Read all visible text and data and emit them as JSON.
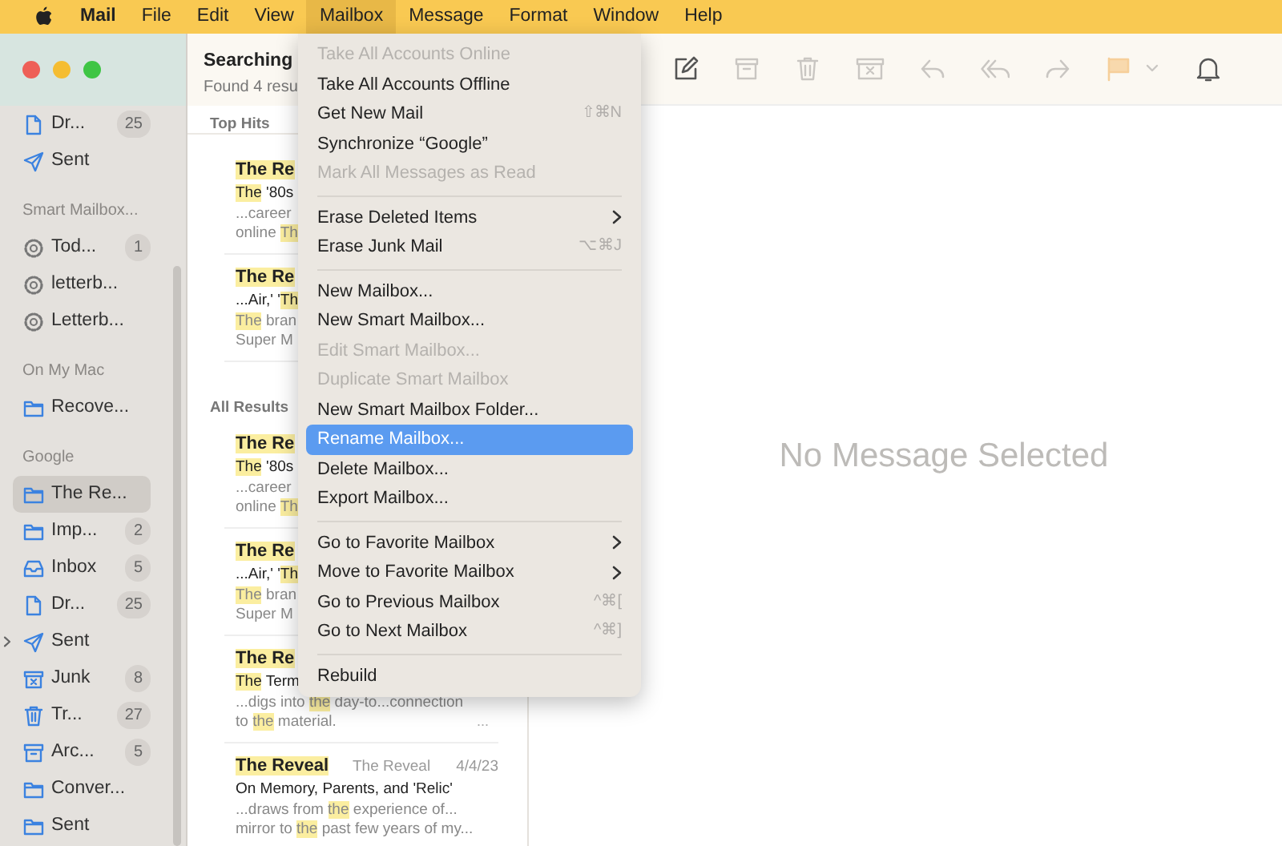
{
  "menubar": [
    {
      "kind": "apple",
      "selected": false
    },
    {
      "kind": "app",
      "label": "Mail",
      "selected": false
    },
    {
      "kind": "menu",
      "label": "File",
      "selected": false
    },
    {
      "kind": "menu",
      "label": "Edit",
      "selected": false
    },
    {
      "kind": "menu",
      "label": "View",
      "selected": false
    },
    {
      "kind": "menu",
      "label": "Mailbox",
      "selected": true
    },
    {
      "kind": "menu",
      "label": "Message",
      "selected": false
    },
    {
      "kind": "menu",
      "label": "Format",
      "selected": false
    },
    {
      "kind": "menu",
      "label": "Window",
      "selected": false
    },
    {
      "kind": "menu",
      "label": "Help",
      "selected": false
    }
  ],
  "sidebar": {
    "items": [
      {
        "kind": "drafts",
        "label": "Dr...",
        "count": "25",
        "selected": false
      },
      {
        "kind": "sent",
        "label": "Sent",
        "selected": false
      },
      {
        "kind": "section",
        "label": "Smart Mailbox..."
      },
      {
        "kind": "smart",
        "label": "Tod...",
        "count": "1",
        "selected": false
      },
      {
        "kind": "smart",
        "label": "letterb...",
        "selected": false
      },
      {
        "kind": "smart",
        "label": "Letterb...",
        "selected": false
      },
      {
        "kind": "section",
        "label": "On My Mac"
      },
      {
        "kind": "folder",
        "label": "Recove...",
        "selected": false
      },
      {
        "kind": "section",
        "label": "Google"
      },
      {
        "kind": "folder",
        "label": "The Re...",
        "selected": true
      },
      {
        "kind": "folder",
        "label": "Imp...",
        "count": "2",
        "selected": false
      },
      {
        "kind": "inbox",
        "label": "Inbox",
        "count": "5",
        "selected": false
      },
      {
        "kind": "drafts",
        "label": "Dr...",
        "count": "25",
        "selected": false
      },
      {
        "kind": "sent",
        "label": "Sent",
        "expanded": false,
        "selected": false
      },
      {
        "kind": "junk",
        "label": "Junk",
        "count": "8",
        "selected": false
      },
      {
        "kind": "trash",
        "label": "Tr...",
        "count": "27",
        "selected": false
      },
      {
        "kind": "archive",
        "label": "Arc...",
        "count": "5",
        "selected": false
      },
      {
        "kind": "folder",
        "label": "Conver...",
        "selected": false
      },
      {
        "kind": "folder",
        "label": "Sent",
        "selected": false
      }
    ]
  },
  "message_list": {
    "title": "Searching",
    "subtitle": "Found 4 resu",
    "groups": [
      {
        "label": "Top Hits",
        "messages": [
          {
            "sender": [
              {
                "text": "The Re",
                "hit": true
              }
            ],
            "subject": [
              {
                "text": "The",
                "hit": true
              },
              {
                "text": " '80s",
                "hit": false
              }
            ],
            "snippet": [
              [
                {
                  "text": "...career",
                  "hit": false
                }
              ],
              [
                {
                  "text": "online ",
                  "hit": false
                },
                {
                  "text": "Th",
                  "hit": true
                }
              ]
            ]
          },
          {
            "sender": [
              {
                "text": "The Re",
                "hit": true
              }
            ],
            "subject": [
              {
                "text": "...Air,' '",
                "hit": false
              },
              {
                "text": "Th",
                "hit": true
              }
            ],
            "snippet": [
              [
                {
                  "text": "The",
                  "hit": true
                },
                {
                  "text": " bran",
                  "hit": false
                }
              ],
              [
                {
                  "text": "Super M",
                  "hit": false
                }
              ]
            ]
          }
        ]
      },
      {
        "label": "All Results",
        "messages": [
          {
            "sender": [
              {
                "text": "The Re",
                "hit": true
              }
            ],
            "subject": [
              {
                "text": "The",
                "hit": true
              },
              {
                "text": " '80s",
                "hit": false
              }
            ],
            "snippet": [
              [
                {
                  "text": "...career",
                  "hit": false
                }
              ],
              [
                {
                  "text": "online ",
                  "hit": false
                },
                {
                  "text": "Th",
                  "hit": true
                }
              ]
            ]
          },
          {
            "sender": [
              {
                "text": "The Re",
                "hit": true
              }
            ],
            "subject": [
              {
                "text": "...Air,' '",
                "hit": false
              },
              {
                "text": "Th",
                "hit": true
              }
            ],
            "snippet": [
              [
                {
                  "text": "The",
                  "hit": true
                },
                {
                  "text": " bran",
                  "hit": false
                }
              ],
              [
                {
                  "text": "Super M",
                  "hit": false
                }
              ]
            ]
          },
          {
            "sender": [
              {
                "text": "The Re",
                "hit": true
              }
            ],
            "subject": [
              {
                "text": "The",
                "hit": true
              },
              {
                "text": " Term",
                "hit": false
              }
            ],
            "snippet": [
              [
                {
                  "text": "...digs into ",
                  "hit": false
                },
                {
                  "text": "the",
                  "hit": true
                },
                {
                  "text": " day-to...connection",
                  "hit": false
                }
              ],
              [
                {
                  "text": "to ",
                  "hit": false
                },
                {
                  "text": "the",
                  "hit": true
                },
                {
                  "text": " material.",
                  "hit": false
                }
              ]
            ],
            "more": "..."
          },
          {
            "sender": [
              {
                "text": "The Reveal",
                "hit": true
              }
            ],
            "mailbox": "The Reveal",
            "date": "4/4/23",
            "subject": [
              {
                "text": "On Memory, Parents, and 'Relic'",
                "hit": false
              }
            ],
            "snippet": [
              [
                {
                  "text": "...draws from ",
                  "hit": false
                },
                {
                  "text": "the",
                  "hit": true
                },
                {
                  "text": " experience of...",
                  "hit": false
                }
              ],
              [
                {
                  "text": "mirror to ",
                  "hit": false
                },
                {
                  "text": "the",
                  "hit": true
                },
                {
                  "text": " past few years of my...",
                  "hit": false
                }
              ]
            ]
          }
        ]
      }
    ]
  },
  "toolbar": {
    "buttons": [
      {
        "kind": "compose",
        "disabled": false
      },
      {
        "kind": "archive",
        "disabled": true
      },
      {
        "kind": "trash",
        "disabled": true
      },
      {
        "kind": "junk",
        "disabled": true
      },
      {
        "kind": "reply",
        "disabled": true
      },
      {
        "kind": "reply_all",
        "disabled": true
      },
      {
        "kind": "forward",
        "disabled": true
      },
      {
        "kind": "flag",
        "disabled": true
      },
      {
        "kind": "chevron",
        "disabled": true
      },
      {
        "kind": "bell",
        "disabled": false
      }
    ]
  },
  "viewer": {
    "placeholder": "No Message Selected"
  },
  "menu": {
    "items": [
      {
        "kind": "item",
        "label": "Take All Accounts Online",
        "disabled": true,
        "selected": false
      },
      {
        "kind": "item",
        "label": "Take All Accounts Offline",
        "disabled": false,
        "selected": false
      },
      {
        "kind": "item",
        "label": "Get New Mail",
        "shortcut": "⇧⌘N",
        "disabled": false,
        "selected": false
      },
      {
        "kind": "item",
        "label": "Synchronize “Google”",
        "disabled": false,
        "selected": false
      },
      {
        "kind": "item",
        "label": "Mark All Messages as Read",
        "disabled": true,
        "selected": false
      },
      {
        "kind": "separator"
      },
      {
        "kind": "item",
        "label": "Erase Deleted Items",
        "submenu": true,
        "disabled": false,
        "selected": false
      },
      {
        "kind": "item",
        "label": "Erase Junk Mail",
        "shortcut": "⌥⌘J",
        "disabled": false,
        "selected": false
      },
      {
        "kind": "separator"
      },
      {
        "kind": "item",
        "label": "New Mailbox...",
        "disabled": false,
        "selected": false
      },
      {
        "kind": "item",
        "label": "New Smart Mailbox...",
        "disabled": false,
        "selected": false
      },
      {
        "kind": "item",
        "label": "Edit Smart Mailbox...",
        "disabled": true,
        "selected": false
      },
      {
        "kind": "item",
        "label": "Duplicate Smart Mailbox",
        "disabled": true,
        "selected": false
      },
      {
        "kind": "item",
        "label": "New Smart Mailbox Folder...",
        "disabled": false,
        "selected": false
      },
      {
        "kind": "item",
        "label": "Rename Mailbox...",
        "disabled": false,
        "selected": true
      },
      {
        "kind": "item",
        "label": "Delete Mailbox...",
        "disabled": false,
        "selected": false
      },
      {
        "kind": "item",
        "label": "Export Mailbox...",
        "disabled": false,
        "selected": false
      },
      {
        "kind": "separator"
      },
      {
        "kind": "item",
        "label": "Go to Favorite Mailbox",
        "submenu": true,
        "disabled": false,
        "selected": false
      },
      {
        "kind": "item",
        "label": "Move to Favorite Mailbox",
        "submenu": true,
        "disabled": false,
        "selected": false
      },
      {
        "kind": "item",
        "label": "Go to Previous Mailbox",
        "shortcut": "^⌘[",
        "disabled": false,
        "selected": false
      },
      {
        "kind": "item",
        "label": "Go to Next Mailbox",
        "shortcut": "^⌘]",
        "disabled": false,
        "selected": false
      },
      {
        "kind": "separator"
      },
      {
        "kind": "item",
        "label": "Rebuild",
        "disabled": false,
        "selected": false
      }
    ]
  }
}
